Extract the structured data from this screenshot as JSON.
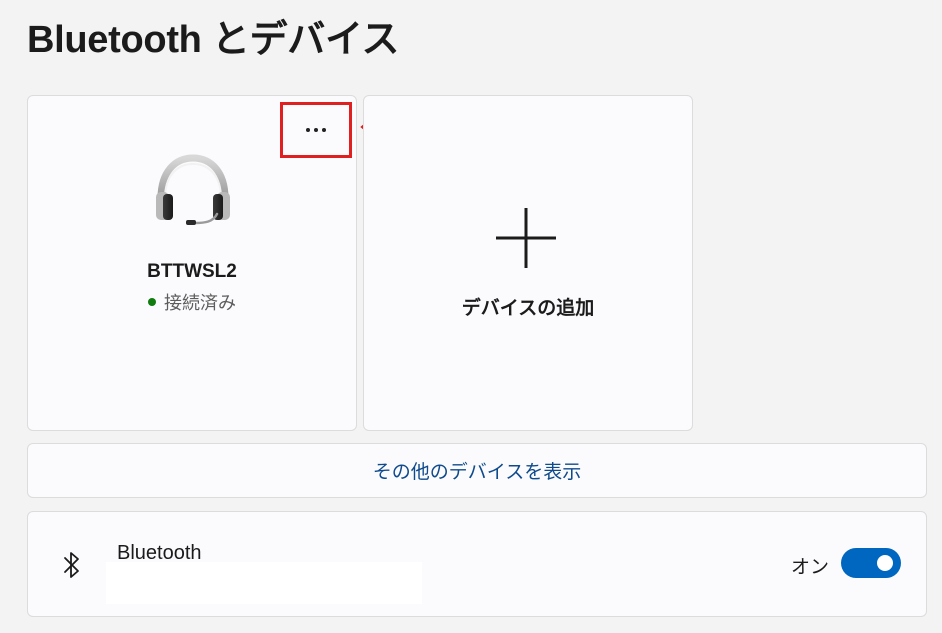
{
  "page": {
    "title": "Bluetooth とデバイス"
  },
  "devices": [
    {
      "name": "BTTWSL2",
      "status": "接続済み",
      "icon": "headset-icon",
      "status_color": "#107c10"
    }
  ],
  "add_device": {
    "label": "デバイスの追加",
    "icon": "plus-icon"
  },
  "more_devices": {
    "label": "その他のデバイスを表示"
  },
  "bluetooth": {
    "label": "Bluetooth",
    "icon": "bluetooth-icon",
    "toggle_state": "オン",
    "toggle_on": true
  },
  "colors": {
    "accent": "#0067c0",
    "highlight": "#e02020",
    "link": "#0f4a8c"
  }
}
